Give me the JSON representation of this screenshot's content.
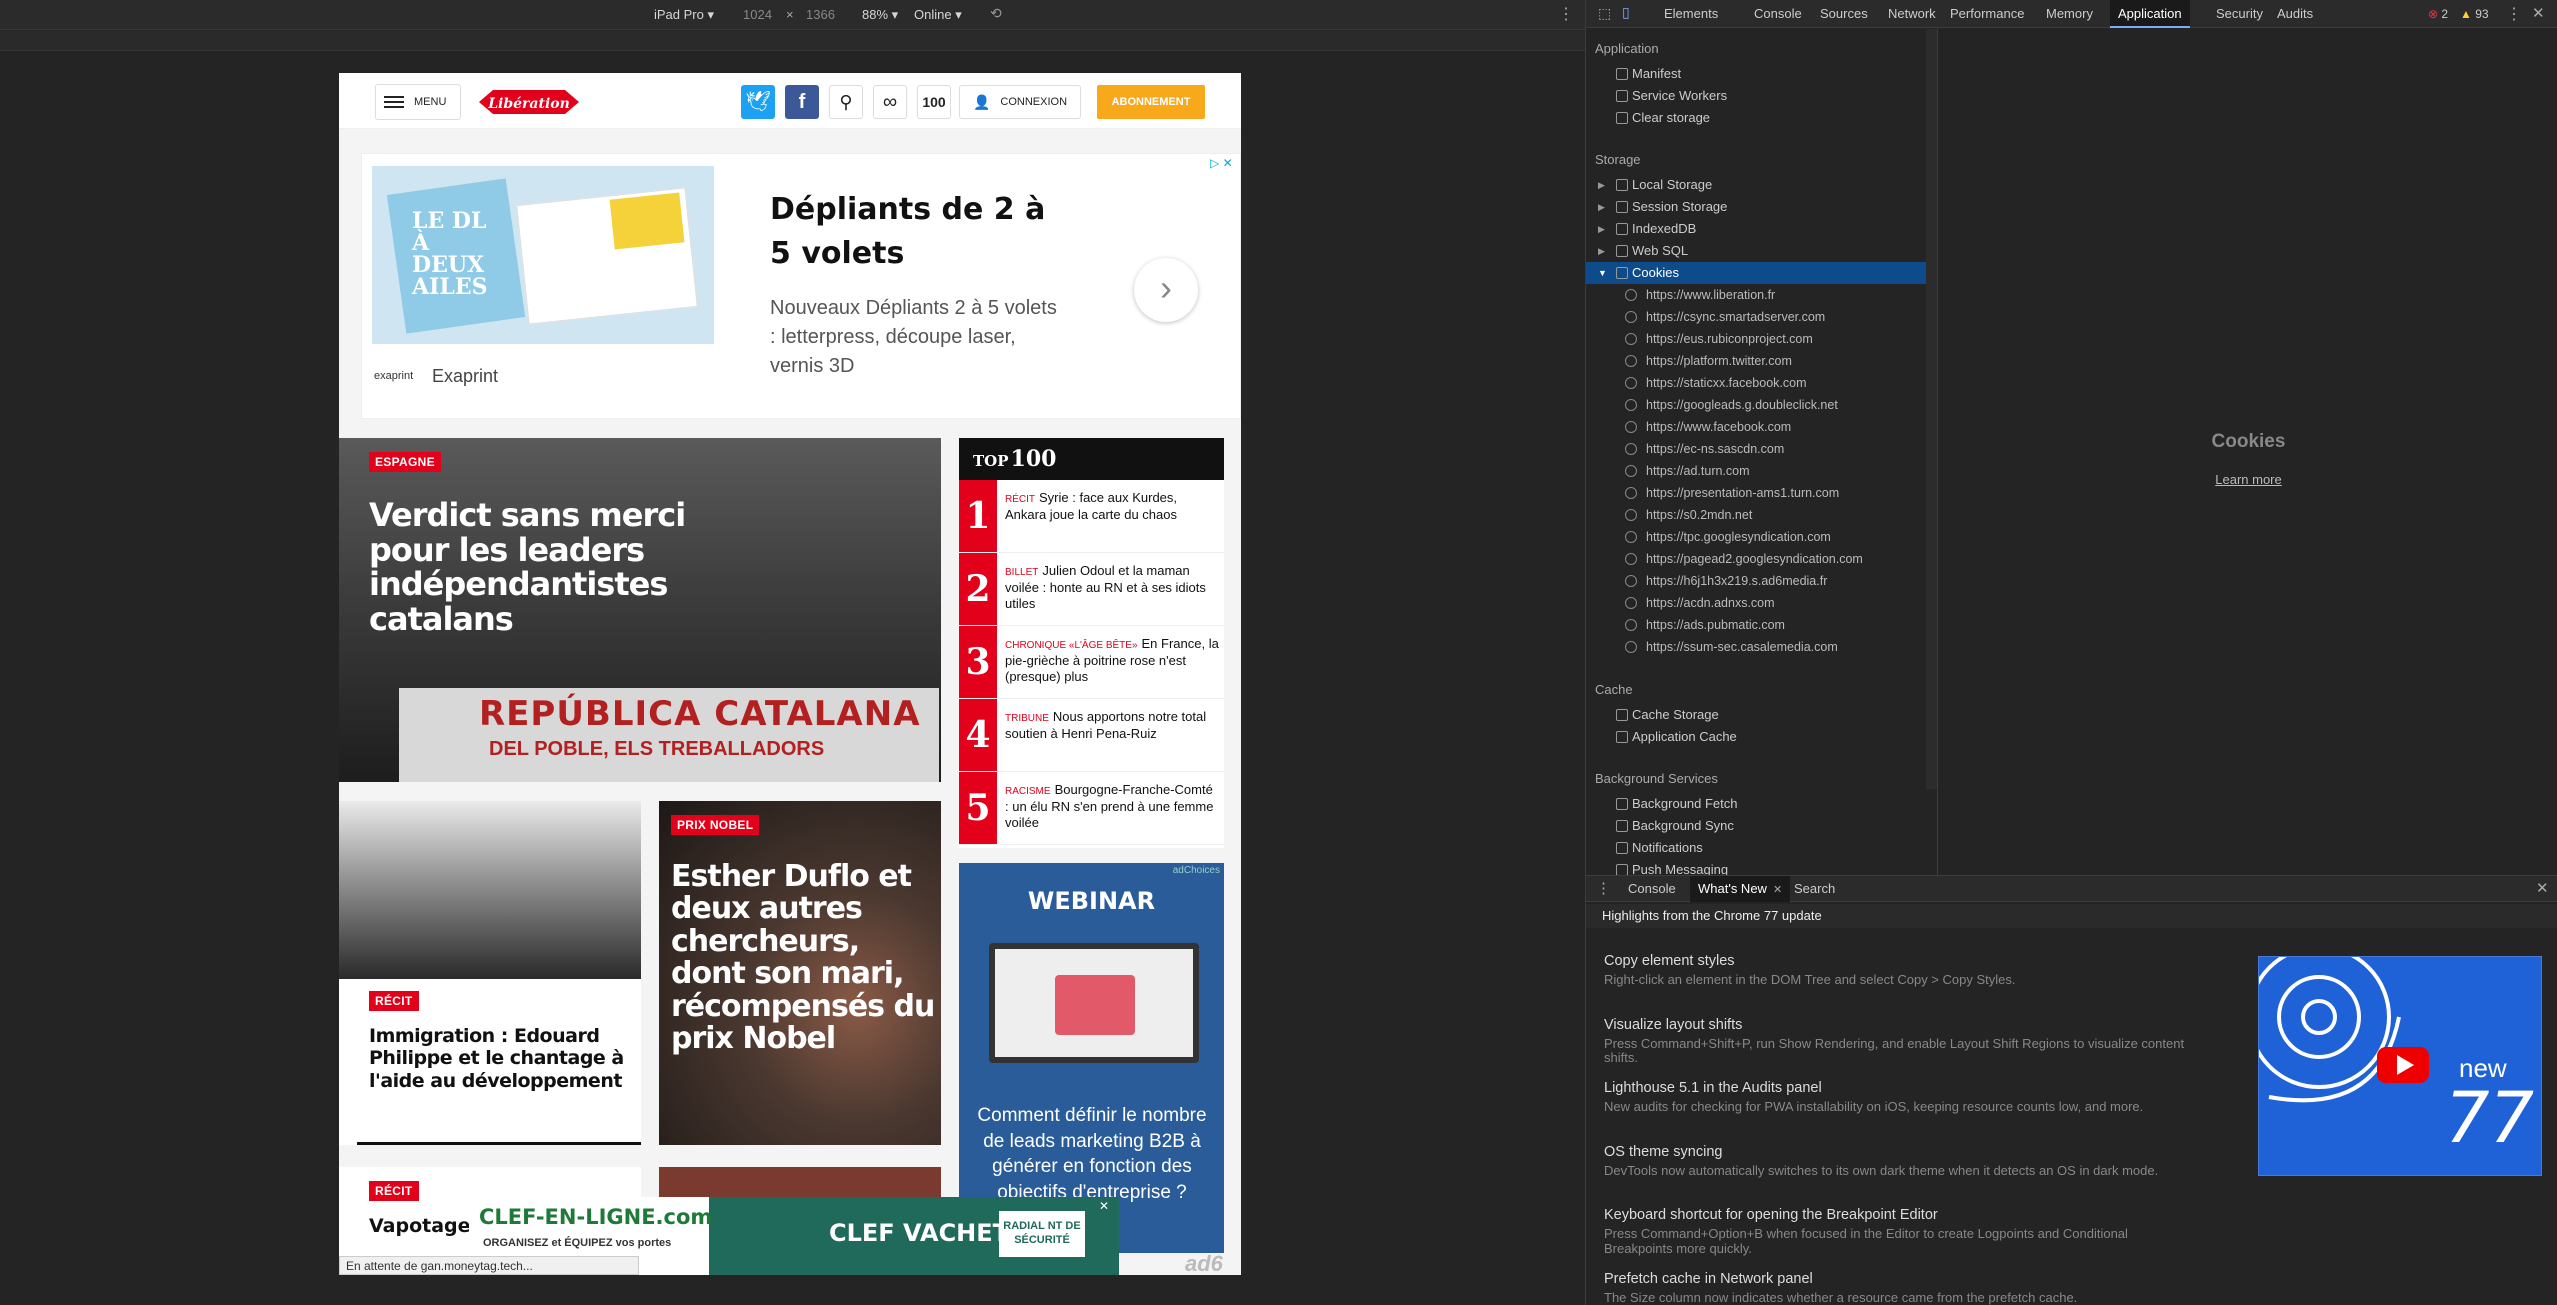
{
  "emulation": {
    "device": "iPad Pro ▾",
    "width": "1024",
    "times": "×",
    "height": "1366",
    "zoom": "88% ▾",
    "network": "Online ▾"
  },
  "site": {
    "menu_label": "MENU",
    "logo_text": "Libération",
    "count_label": "100",
    "connexion_label": "CONNEXION",
    "abonnement_label": "ABONNEMENT",
    "status_text": "En attente de gan.moneytag.tech..."
  },
  "ad_top": {
    "title": "Dépliants de 2 à 5 volets",
    "desc": "Nouveaux Dépliants 2 à 5 volets : letterpress, découpe laser, vernis 3D",
    "brand": "Exaprint",
    "brand_logo": "exaprint",
    "image_text": "LE DL À DEUX AILES",
    "adchoices": "▷ ✕"
  },
  "articles": {
    "main": {
      "tag": "ESPAGNE",
      "title": "Verdict sans merci pour les leaders indépendantistes catalans",
      "banner": "REPÚBLICA CATALANA",
      "banner_sub": "DEL POBLE, ELS TREBALLADORS"
    },
    "second": {
      "tag": "RÉCIT",
      "title": "Immigration : Edouard Philippe et le chantage à l'aide au développement"
    },
    "third": {
      "tag": "PRIX NOBEL",
      "title": "Esther Duflo et deux autres chercheurs, dont son mari, récompensés du prix Nobel"
    },
    "fourth": {
      "tag": "RÉCIT",
      "title": "Vapotage : ..."
    }
  },
  "top100": {
    "header_a": "TOP",
    "header_b": "100",
    "items": [
      {
        "num": "1",
        "kicker": "RÉCIT",
        "text": "Syrie : face aux Kurdes, Ankara joue la carte du chaos"
      },
      {
        "num": "2",
        "kicker": "BILLET",
        "text": "Julien Odoul et la maman voilée : honte au RN et à ses idiots utiles"
      },
      {
        "num": "3",
        "kicker": "CHRONIQUE «L'ÂGE BÊTE»",
        "text": "En France, la pie-grièche à poitrine rose n'est (presque) plus"
      },
      {
        "num": "4",
        "kicker": "TRIBUNE",
        "text": "Nous apportons notre total soutien à Henri Pena-Ruiz"
      },
      {
        "num": "5",
        "kicker": "RACISME",
        "text": "Bourgogne-Franche-Comté : un élu RN s'en prend à une femme voilée"
      }
    ]
  },
  "ad_webinar": {
    "label": "WEBINAR",
    "text": "Comment définir le nombre de leads marketing B2B à générer en fonction des objectifs d'entreprise ?",
    "badge": "adChoices"
  },
  "ad_bottom": {
    "brand": "CLEF-EN-LIGNE.com",
    "tagline": "ORGANISEZ et ÉQUIPEZ vos portes",
    "product": "CLEF VACHETTE",
    "badge": "RADIAL NT DE SÉCURITÉ",
    "ad6": "ad6"
  },
  "devtools": {
    "tabs": [
      "Elements",
      "Console",
      "Sources",
      "Network",
      "Performance",
      "Memory",
      "Application",
      "Security",
      "Audits"
    ],
    "active_tab": "Application",
    "errors": "2",
    "warnings": "93",
    "sections": {
      "application": "Application",
      "storage": "Storage",
      "cache": "Cache",
      "background": "Background Services"
    },
    "application_items": [
      "Manifest",
      "Service Workers",
      "Clear storage"
    ],
    "storage_items": [
      "Local Storage",
      "Session Storage",
      "IndexedDB",
      "Web SQL",
      "Cookies"
    ],
    "cookies": [
      "https://www.liberation.fr",
      "https://csync.smartadserver.com",
      "https://eus.rubiconproject.com",
      "https://platform.twitter.com",
      "https://staticxx.facebook.com",
      "https://googleads.g.doubleclick.net",
      "https://www.facebook.com",
      "https://ec-ns.sascdn.com",
      "https://ad.turn.com",
      "https://presentation-ams1.turn.com",
      "https://s0.2mdn.net",
      "https://tpc.googlesyndication.com",
      "https://pagead2.googlesyndication.com",
      "https://h6j1h3x219.s.ad6media.fr",
      "https://acdn.adnxs.com",
      "https://ads.pubmatic.com",
      "https://ssum-sec.casalemedia.com"
    ],
    "cache_items": [
      "Cache Storage",
      "Application Cache"
    ],
    "background_items": [
      "Background Fetch",
      "Background Sync",
      "Notifications",
      "Push Messaging"
    ],
    "empty_title": "Cookies",
    "learn_more": "Learn more",
    "drawer_tabs": [
      "Console",
      "What's New",
      "Search"
    ],
    "drawer_active": "What's New",
    "whatsnew_header": "Highlights from the Chrome 77 update",
    "whatsnew": [
      {
        "title": "Copy element styles",
        "desc": "Right-click an element in the DOM Tree and select Copy > Copy Styles."
      },
      {
        "title": "Visualize layout shifts",
        "desc": "Press Command+Shift+P, run Show Rendering, and enable Layout Shift Regions to visualize content shifts."
      },
      {
        "title": "Lighthouse 5.1 in the Audits panel",
        "desc": "New audits for checking for PWA installability on iOS, keeping resource counts low, and more."
      },
      {
        "title": "OS theme syncing",
        "desc": "DevTools now automatically switches to its own dark theme when it detects an OS in dark mode."
      },
      {
        "title": "Keyboard shortcut for opening the Breakpoint Editor",
        "desc": "Press Command+Option+B when focused in the Editor to create Logpoints and Conditional Breakpoints more quickly."
      },
      {
        "title": "Prefetch cache in Network panel",
        "desc": "The Size column now indicates whether a resource came from the prefetch cache."
      }
    ],
    "video_new": "new",
    "video_num": "77"
  }
}
